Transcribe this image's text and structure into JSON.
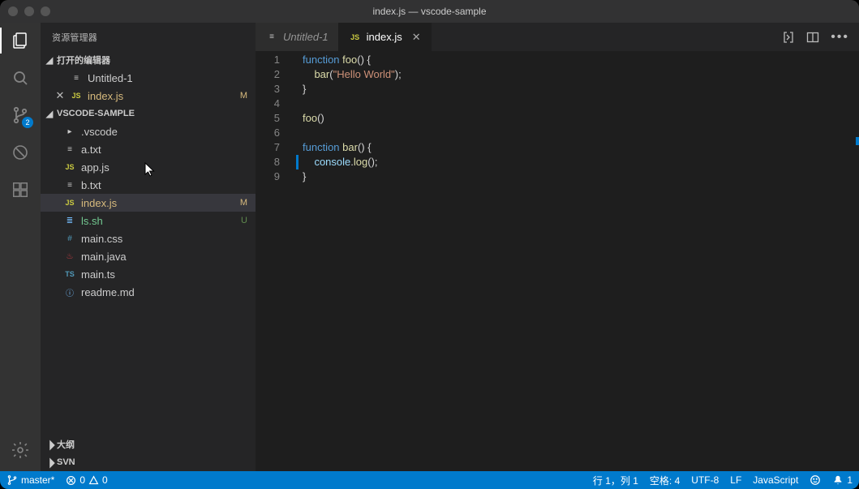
{
  "titlebar": {
    "title": "index.js — vscode-sample"
  },
  "sidebar": {
    "title": "资源管理器",
    "openEditors": {
      "title": "打开的编辑器"
    },
    "openEditorItems": [
      {
        "name": "Untitled-1",
        "icon": "lines"
      },
      {
        "name": "index.js",
        "icon": "js",
        "modified": true,
        "gitLetter": "M"
      }
    ],
    "workspace": {
      "title": "VSCODE-SAMPLE"
    },
    "files": [
      {
        "name": ".vscode",
        "icon": "chev"
      },
      {
        "name": "a.txt",
        "icon": "lines"
      },
      {
        "name": "app.js",
        "icon": "js"
      },
      {
        "name": "b.txt",
        "icon": "lines"
      },
      {
        "name": "index.js",
        "icon": "js",
        "modified": true,
        "gitLetter": "M",
        "selected": true
      },
      {
        "name": "ls.sh",
        "icon": "sh",
        "gitLetter": "U"
      },
      {
        "name": "main.css",
        "icon": "hash"
      },
      {
        "name": "main.java",
        "icon": "java"
      },
      {
        "name": "main.ts",
        "icon": "ts"
      },
      {
        "name": "readme.md",
        "icon": "info"
      }
    ],
    "outline": {
      "title": "大纲"
    },
    "svn": {
      "title": "SVN"
    }
  },
  "activitybar": {
    "scmBadge": "2"
  },
  "tabs": [
    {
      "name": "Untitled-1",
      "icon": "lines"
    },
    {
      "name": "index.js",
      "icon": "js",
      "active": true
    }
  ],
  "code": {
    "lines": [
      "1",
      "2",
      "3",
      "4",
      "5",
      "6",
      "7",
      "8",
      "9"
    ]
  },
  "statusbar": {
    "branch": "master*",
    "errors": "0",
    "warnings": "0",
    "lineCol": "行 1，列 1",
    "spaces": "空格: 4",
    "encoding": "UTF-8",
    "eol": "LF",
    "lang": "JavaScript",
    "bell": "1"
  }
}
